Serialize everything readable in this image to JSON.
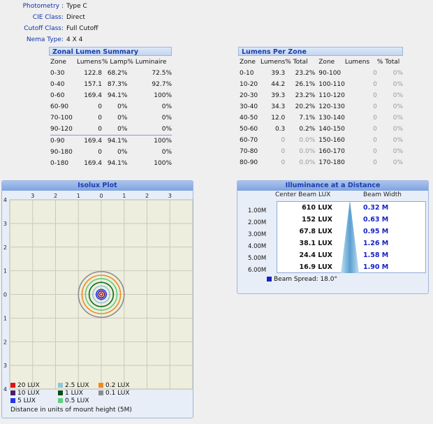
{
  "meta": [
    {
      "key": "Photometry :",
      "value": "Type C"
    },
    {
      "key": "CIE Class:",
      "value": "Direct"
    },
    {
      "key": "Cutoff Class:",
      "value": "Full Cutoff"
    },
    {
      "key": "Nema Type:",
      "value": "4 X 4"
    }
  ],
  "zonal_summary": {
    "title": "Zonal Lumen Summary",
    "headers": [
      "Zone",
      "Lumens",
      "% Lamp",
      "% Luminaire"
    ],
    "rows": [
      {
        "zone": "0-30",
        "lumens": "122.8",
        "lamp": "68.2%",
        "lum": "72.5%"
      },
      {
        "zone": "0-40",
        "lumens": "157.1",
        "lamp": "87.3%",
        "lum": "92.7%"
      },
      {
        "zone": "0-60",
        "lumens": "169.4",
        "lamp": "94.1%",
        "lum": "100%"
      },
      {
        "zone": "60-90",
        "lumens": "0",
        "lamp": "0%",
        "lum": "0%"
      },
      {
        "zone": "70-100",
        "lumens": "0",
        "lamp": "0%",
        "lum": "0%"
      },
      {
        "zone": "90-120",
        "lumens": "0",
        "lamp": "0%",
        "lum": "0%"
      },
      {
        "zone": "0-90",
        "lumens": "169.4",
        "lamp": "94.1%",
        "lum": "100%"
      },
      {
        "zone": "90-180",
        "lumens": "0",
        "lamp": "0%",
        "lum": "0%"
      },
      {
        "zone": "0-180",
        "lumens": "169.4",
        "lamp": "94.1%",
        "lum": "100%"
      }
    ]
  },
  "lumens_per_zone": {
    "title": "Lumens Per Zone",
    "headers": [
      "Zone",
      "Lumens",
      "% Total",
      "Zone",
      "Lumens",
      "% Total"
    ],
    "rows": [
      {
        "z1": "0-10",
        "l1": "39.3",
        "t1": "23.2%",
        "z2": "90-100",
        "l2": "0",
        "t2": "0%"
      },
      {
        "z1": "10-20",
        "l1": "44.2",
        "t1": "26.1%",
        "z2": "100-110",
        "l2": "0",
        "t2": "0%"
      },
      {
        "z1": "20-30",
        "l1": "39.3",
        "t1": "23.2%",
        "z2": "110-120",
        "l2": "0",
        "t2": "0%"
      },
      {
        "z1": "30-40",
        "l1": "34.3",
        "t1": "20.2%",
        "z2": "120-130",
        "l2": "0",
        "t2": "0%"
      },
      {
        "z1": "40-50",
        "l1": "12.0",
        "t1": "7.1%",
        "z2": "130-140",
        "l2": "0",
        "t2": "0%"
      },
      {
        "z1": "50-60",
        "l1": "0.3",
        "t1": "0.2%",
        "z2": "140-150",
        "l2": "0",
        "t2": "0%"
      },
      {
        "z1": "60-70",
        "l1": "0",
        "t1": "0.0%",
        "z2": "150-160",
        "l2": "0",
        "t2": "0%"
      },
      {
        "z1": "70-80",
        "l1": "0",
        "t1": "0.0%",
        "z2": "160-170",
        "l2": "0",
        "t2": "0%"
      },
      {
        "z1": "80-90",
        "l1": "0",
        "t1": "0.0%",
        "z2": "170-180",
        "l2": "0",
        "t2": "0%"
      }
    ]
  },
  "isolux": {
    "title": "Isolux Plot",
    "x_ticks": [
      "3",
      "2",
      "1",
      "0",
      "1",
      "2",
      "3"
    ],
    "y_ticks": [
      "4",
      "3",
      "2",
      "1",
      "0",
      "1",
      "2",
      "3",
      "4"
    ],
    "rings": [
      {
        "r": 0.07,
        "color": "#cc1111"
      },
      {
        "r": 0.15,
        "color": "#4a1e66"
      },
      {
        "r": 0.22,
        "color": "#2233ee"
      },
      {
        "r": 0.37,
        "color": "#8ec8d8"
      },
      {
        "r": 0.53,
        "color": "#0e6a1a"
      },
      {
        "r": 0.69,
        "color": "#5fd07a"
      },
      {
        "r": 0.84,
        "color": "#f08a20"
      },
      {
        "r": 1.0,
        "color": "#8c8c8c"
      }
    ],
    "legend": [
      {
        "label": "20 LUX",
        "color": "#e01010"
      },
      {
        "label": "2.5 LUX",
        "color": "#8ec8d8"
      },
      {
        "label": "0.2 LUX",
        "color": "#f08a20"
      },
      {
        "label": "10 LUX",
        "color": "#4a1e66"
      },
      {
        "label": "1 LUX",
        "color": "#0e4a14"
      },
      {
        "label": "0.1 LUX",
        "color": "#8c8c8c"
      },
      {
        "label": "5 LUX",
        "color": "#2233ee"
      },
      {
        "label": "0.5 LUX",
        "color": "#5fd07a"
      }
    ],
    "note": "Distance in units of mount height (5M)"
  },
  "illuminance": {
    "title": "Illuminance at a Distance",
    "col1": "Center Beam LUX",
    "col2": "Beam Width",
    "distances": [
      "1.00M",
      "2.00M",
      "3.00M",
      "4.00M",
      "5.00M",
      "6.00M"
    ],
    "rows": [
      {
        "lux": "610 LUX",
        "width": "0.32 M"
      },
      {
        "lux": "152 LUX",
        "width": "0.63 M"
      },
      {
        "lux": "67.8 LUX",
        "width": "0.95 M"
      },
      {
        "lux": "38.1 LUX",
        "width": "1.26 M"
      },
      {
        "lux": "24.4 LUX",
        "width": "1.58 M"
      },
      {
        "lux": "16.9 LUX",
        "width": "1.90 M"
      }
    ],
    "spread": "Beam Spread: 18.0°",
    "spread_color": "#1622c8"
  }
}
